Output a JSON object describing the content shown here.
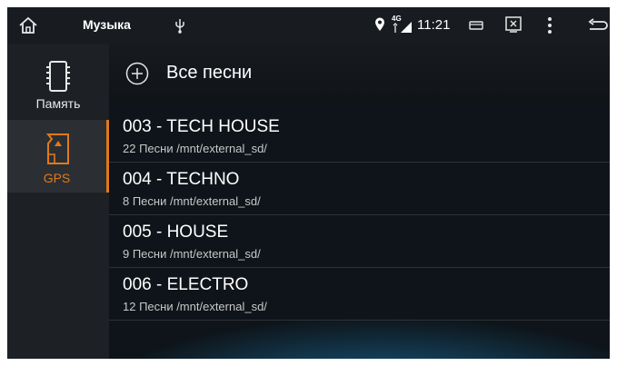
{
  "status_bar": {
    "app_title": "Музыка",
    "network": "4G",
    "time": "11:21",
    "icons": [
      "home-icon",
      "usb-icon",
      "location-icon",
      "signal-icon",
      "window-icon",
      "screenshot-icon",
      "more-icon",
      "back-icon"
    ]
  },
  "sidebar": {
    "items": [
      {
        "label": "Память",
        "icon": "sd-card-icon",
        "active": false
      },
      {
        "label": "GPS",
        "icon": "sd-card-icon",
        "active": true
      }
    ]
  },
  "main": {
    "all_songs_label": "Все песни",
    "folders": [
      {
        "name": "003 - TECH HOUSE",
        "details": "22 Песни /mnt/external_sd/"
      },
      {
        "name": "004 - TECHNO",
        "details": "8 Песни /mnt/external_sd/"
      },
      {
        "name": "005 - HOUSE",
        "details": "9 Песни /mnt/external_sd/"
      },
      {
        "name": "006 - ELECTRO",
        "details": "12 Песни /mnt/external_sd/"
      }
    ]
  },
  "colors": {
    "accent": "#e0791c",
    "background": "#0c1116",
    "sidebar": "#1d2125"
  }
}
